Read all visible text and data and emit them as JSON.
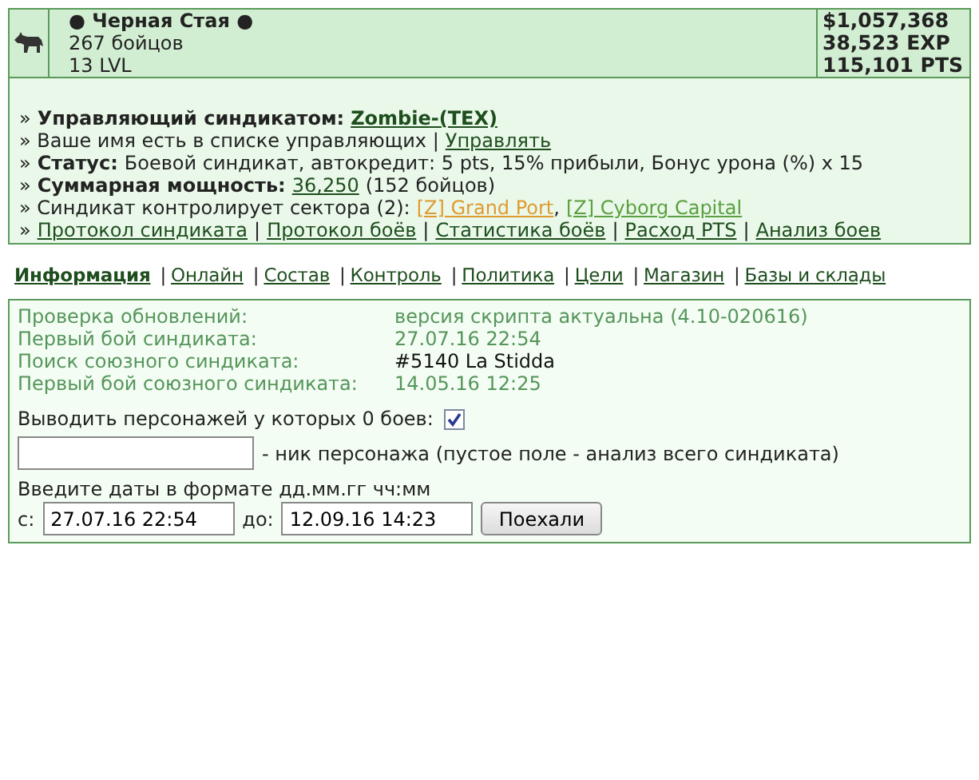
{
  "header": {
    "name": "● Черная Стая ●",
    "fighters": "267 бойцов",
    "level": "13 LVL",
    "stats": [
      "$1,057,368",
      "38,523 EXP",
      "115,101 PTS"
    ]
  },
  "info_lines": [
    [
      {
        "kind": "text",
        "text": "»"
      },
      {
        "kind": "bold",
        "text": "Управляющий синдикатом:"
      },
      {
        "kind": "boldlink",
        "text": "Zombie-(TEX)"
      }
    ],
    [
      {
        "kind": "text",
        "text": "» Ваше имя есть в списке управляющих |"
      },
      {
        "kind": "link",
        "text": "Управлять"
      }
    ],
    [
      {
        "kind": "text",
        "text": "»"
      },
      {
        "kind": "bold",
        "text": "Статус:"
      },
      {
        "kind": "text",
        "text": "Боевой синдикат, автокредит: 5 pts, 15% прибыли, Бонус урона (%) x 15"
      }
    ],
    [
      {
        "kind": "text",
        "text": "»"
      },
      {
        "kind": "bold",
        "text": "Суммарная мощность:"
      },
      {
        "kind": "link",
        "text": "36,250"
      },
      {
        "kind": "text",
        "text": "(152 бойцов)"
      }
    ],
    [
      {
        "kind": "text",
        "text": "» Синдикат контролирует сектора (2):"
      },
      {
        "kind": "link",
        "text": "[Z] Grand Port",
        "color": "#e09a30"
      },
      {
        "kind": "text",
        "text": ","
      },
      {
        "kind": "link",
        "text": "[Z] Cyborg Capital",
        "color": "#5aa040"
      }
    ],
    [
      {
        "kind": "text",
        "text": "»"
      },
      {
        "kind": "link",
        "text": "Протокол синдиката"
      },
      {
        "kind": "text",
        "text": "|"
      },
      {
        "kind": "link",
        "text": "Протокол боёв"
      },
      {
        "kind": "text",
        "text": "|"
      },
      {
        "kind": "link",
        "text": "Статистика боёв"
      },
      {
        "kind": "text",
        "text": "|"
      },
      {
        "kind": "link",
        "text": "Расход PTS"
      },
      {
        "kind": "text",
        "text": "|"
      },
      {
        "kind": "link",
        "text": "Анализ боев"
      }
    ]
  ],
  "tabs": [
    {
      "label": "Информация",
      "selected": true
    },
    {
      "separator": "|",
      "label": "Онлайн",
      "selected": false
    },
    {
      "separator": "|",
      "label": "Состав",
      "selected": false
    },
    {
      "separator": "|",
      "label": "Контроль",
      "selected": false
    },
    {
      "separator": "|",
      "label": "Политика",
      "selected": false
    },
    {
      "separator": "|",
      "label": "Цели",
      "selected": false
    },
    {
      "separator": "|",
      "label": "Магазин",
      "selected": false
    },
    {
      "separator": "|",
      "label": "Базы и склады",
      "selected": false
    }
  ],
  "panel": {
    "rows": [
      {
        "label": "Проверка обновлений:",
        "value": "версия скрипта актуальна (4.10-020616)",
        "emphasized": false
      },
      {
        "label": "Первый бой синдиката:",
        "value": "27.07.16 22:54",
        "emphasized": false
      },
      {
        "label": "Поиск союзного синдиката:",
        "value": "#5140 La Stidda",
        "emphasized": true
      },
      {
        "label": "Первый бой союзного синдиката:",
        "value": "14.05.16 12:25",
        "emphasized": false
      }
    ],
    "zero_fights": {
      "label": "Выводить персонажей у которых 0 боев:",
      "checked": true
    },
    "nick_hint": "- ник персонажа (пустое поле - анализ всего синдиката)",
    "dates_hint": "Введите даты в формате дд.мм.гг чч:мм",
    "from_label": "с:",
    "from_value": "27.07.16 22:54",
    "to_label": "до:",
    "to_value": "12.09.16 14:23",
    "button": "Поехали"
  }
}
